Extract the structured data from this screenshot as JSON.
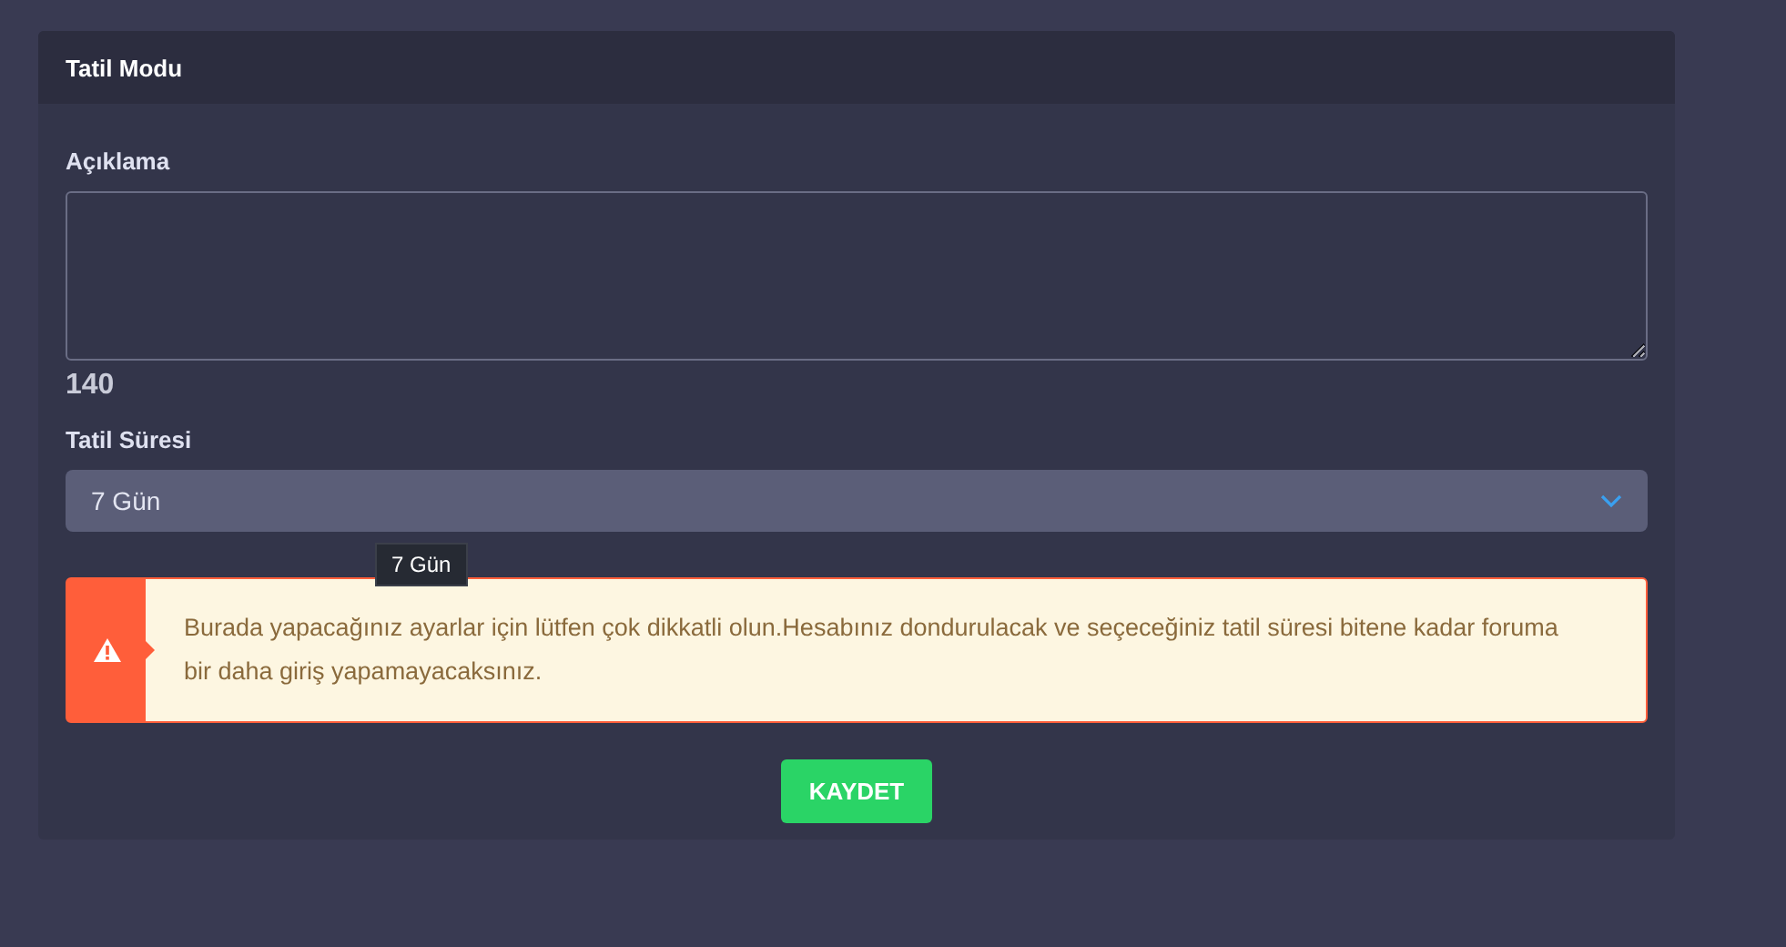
{
  "panel": {
    "title": "Tatil Modu"
  },
  "description": {
    "label": "Açıklama",
    "counter": "140"
  },
  "duration": {
    "label": "Tatil Süresi",
    "value": "7 Gün",
    "tooltip": "7 Gün"
  },
  "alert": {
    "text": "Burada yapacağınız ayarlar için lütfen çok dikkatli olun.Hesabınız dondurulacak ve seçeceğiniz tatil süresi bitene kadar foruma bir daha giriş yapamayacaksınız."
  },
  "buttons": [
    "KAYDET"
  ]
}
